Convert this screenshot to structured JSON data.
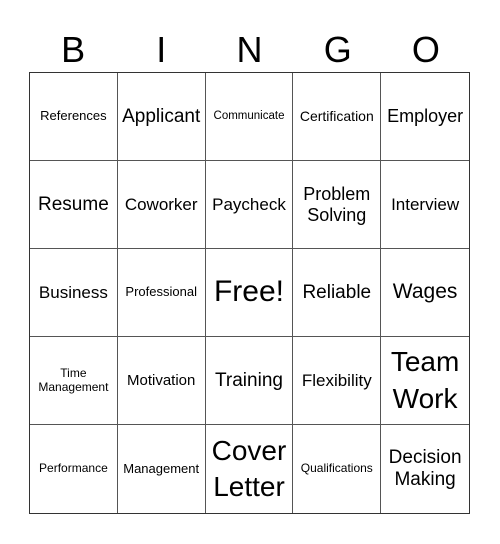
{
  "header": [
    "B",
    "I",
    "N",
    "G",
    "O"
  ],
  "cells": [
    {
      "text": "References"
    },
    {
      "text": "Applicant"
    },
    {
      "text": "Communicate"
    },
    {
      "text": "Certification"
    },
    {
      "text": "Employer"
    },
    {
      "text": "Resume"
    },
    {
      "text": "Coworker"
    },
    {
      "text": "Paycheck"
    },
    {
      "text": "Problem\nSolving"
    },
    {
      "text": "Interview"
    },
    {
      "text": "Business"
    },
    {
      "text": "Professional"
    },
    {
      "text": "Free!"
    },
    {
      "text": "Reliable"
    },
    {
      "text": "Wages"
    },
    {
      "text": "Time\nManagement"
    },
    {
      "text": "Motivation"
    },
    {
      "text": "Training"
    },
    {
      "text": "Flexibility"
    },
    {
      "text": "Team\nWork"
    },
    {
      "text": "Performance"
    },
    {
      "text": "Management"
    },
    {
      "text": "Cover\nLetter"
    },
    {
      "text": "Qualifications"
    },
    {
      "text": "Decision\nMaking"
    }
  ]
}
